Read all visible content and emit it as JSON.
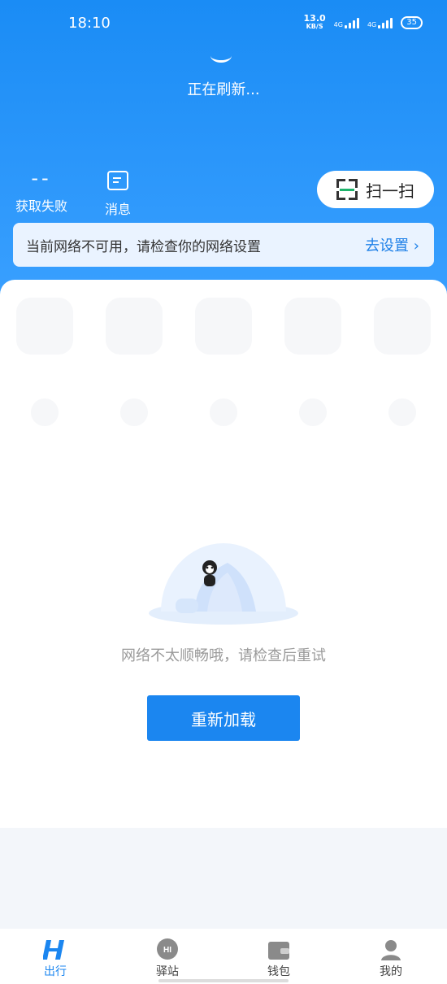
{
  "status_bar": {
    "time": "18:10",
    "speed_value": "13.0",
    "speed_unit": "KB/S",
    "network1": "4G",
    "network2": "4G",
    "battery": "35"
  },
  "header": {
    "refresh_text": "正在刷新...",
    "balance_value": "--",
    "balance_label": "获取失败",
    "messages_label": "消息",
    "scan_label": "扫一扫"
  },
  "notice": {
    "text": "当前网络不可用，请检查你的网络设置",
    "action": "去设置"
  },
  "main": {
    "error_text": "网络不太顺畅哦，请检查后重试",
    "reload_label": "重新加载"
  },
  "tabbar": {
    "tabs": [
      {
        "label": "出行"
      },
      {
        "label": "驿站"
      },
      {
        "label": "钱包"
      },
      {
        "label": "我的"
      }
    ]
  },
  "colors": {
    "brand": "#1b86f0",
    "hero_top": "#1a8cf5",
    "scan_line": "#1db36b"
  }
}
